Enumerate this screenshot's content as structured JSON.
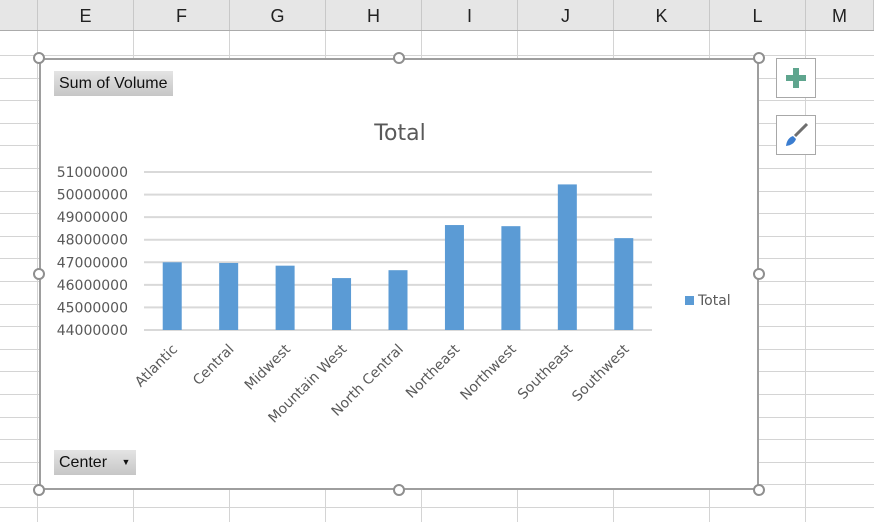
{
  "columns": [
    "E",
    "F",
    "G",
    "H",
    "I",
    "J",
    "K",
    "L",
    "M"
  ],
  "chart_controls": {
    "value_field_button": "Sum of Volume",
    "axis_field_button": "Center",
    "add_element_icon": "plus-icon",
    "style_icon": "paintbrush-icon"
  },
  "colors": {
    "bar": "#5b9bd5",
    "gridline": "#d9d9d9",
    "text": "#595959"
  },
  "chart_data": {
    "type": "bar",
    "title": "Total",
    "xlabel": "",
    "ylabel": "",
    "categories": [
      "Atlantic",
      "Central",
      "Midwest",
      "Mountain West",
      "North Central",
      "Northeast",
      "Northwest",
      "Southeast",
      "Southwest"
    ],
    "series": [
      {
        "name": "Total",
        "values": [
          47000000,
          46970000,
          46850000,
          46300000,
          46650000,
          48650000,
          48600000,
          50450000,
          48070000
        ]
      }
    ],
    "ylim": [
      44000000,
      51000000
    ],
    "yticks": [
      "44000000",
      "45000000",
      "46000000",
      "47000000",
      "48000000",
      "49000000",
      "50000000",
      "51000000"
    ],
    "grid": true,
    "legend": {
      "position": "right",
      "entries": [
        "Total"
      ]
    }
  }
}
